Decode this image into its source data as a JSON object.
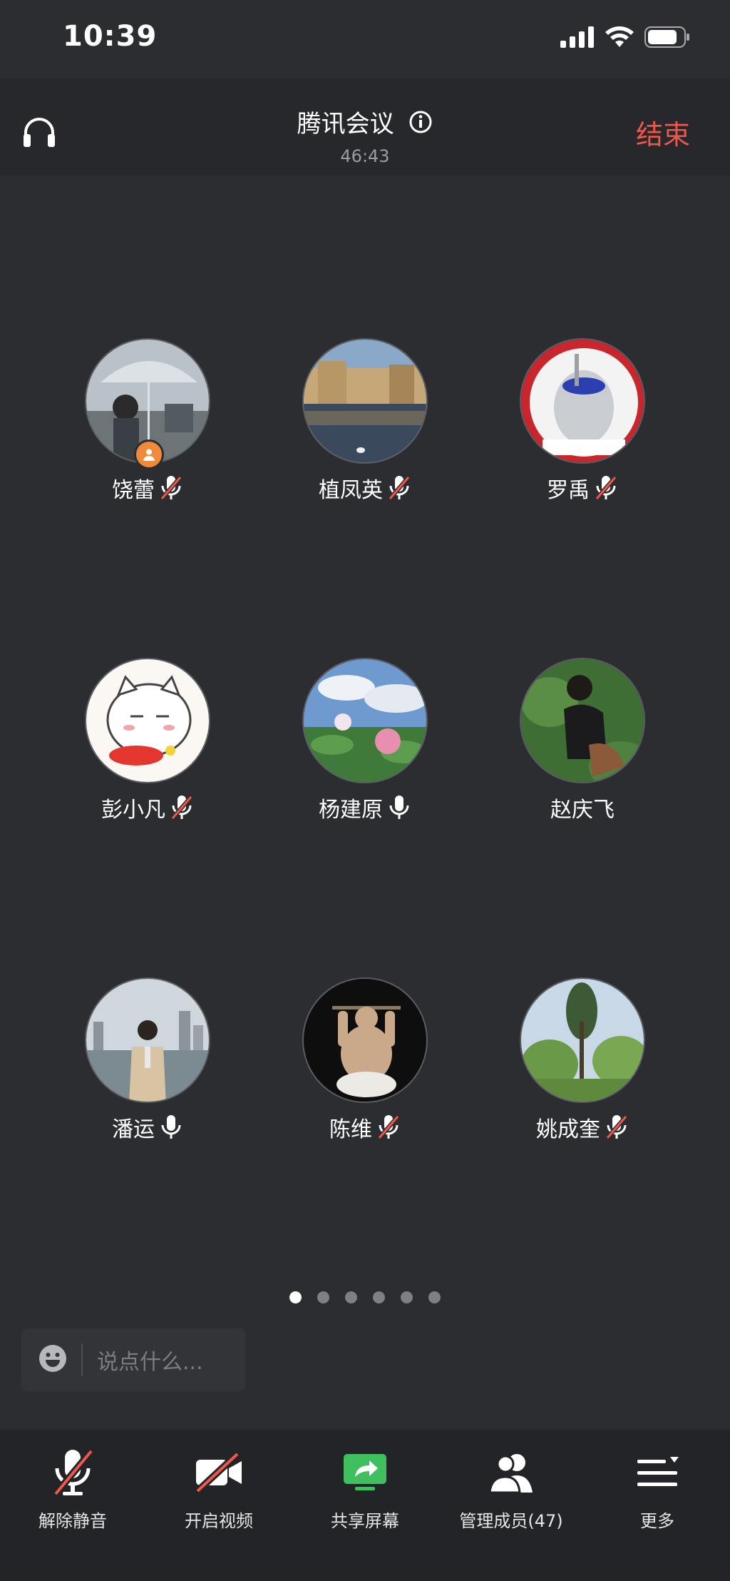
{
  "status": {
    "time": "10:39"
  },
  "header": {
    "title": "腾讯会议",
    "timer": "46:43",
    "end_label": "结束"
  },
  "participants": [
    {
      "name": "饶蕾",
      "mic": "muted",
      "host": true
    },
    {
      "name": "植凤英",
      "mic": "muted"
    },
    {
      "name": "罗禹",
      "mic": "muted"
    },
    {
      "name": "彭小凡",
      "mic": "muted"
    },
    {
      "name": "杨建原",
      "mic": "on"
    },
    {
      "name": "赵庆飞",
      "mic": "none"
    },
    {
      "name": "潘运",
      "mic": "on"
    },
    {
      "name": "陈维",
      "mic": "muted"
    },
    {
      "name": "姚成奎",
      "mic": "muted"
    }
  ],
  "pager": {
    "count": 6,
    "active": 0
  },
  "chat": {
    "placeholder": "说点什么..."
  },
  "toolbar": {
    "unmute": "解除静音",
    "video": "开启视频",
    "share": "共享屏幕",
    "members": "管理成员(47)",
    "more": "更多"
  },
  "colors": {
    "end": "#f0564a",
    "share": "#3fbf5e",
    "host_badge": "#f08a3a"
  }
}
